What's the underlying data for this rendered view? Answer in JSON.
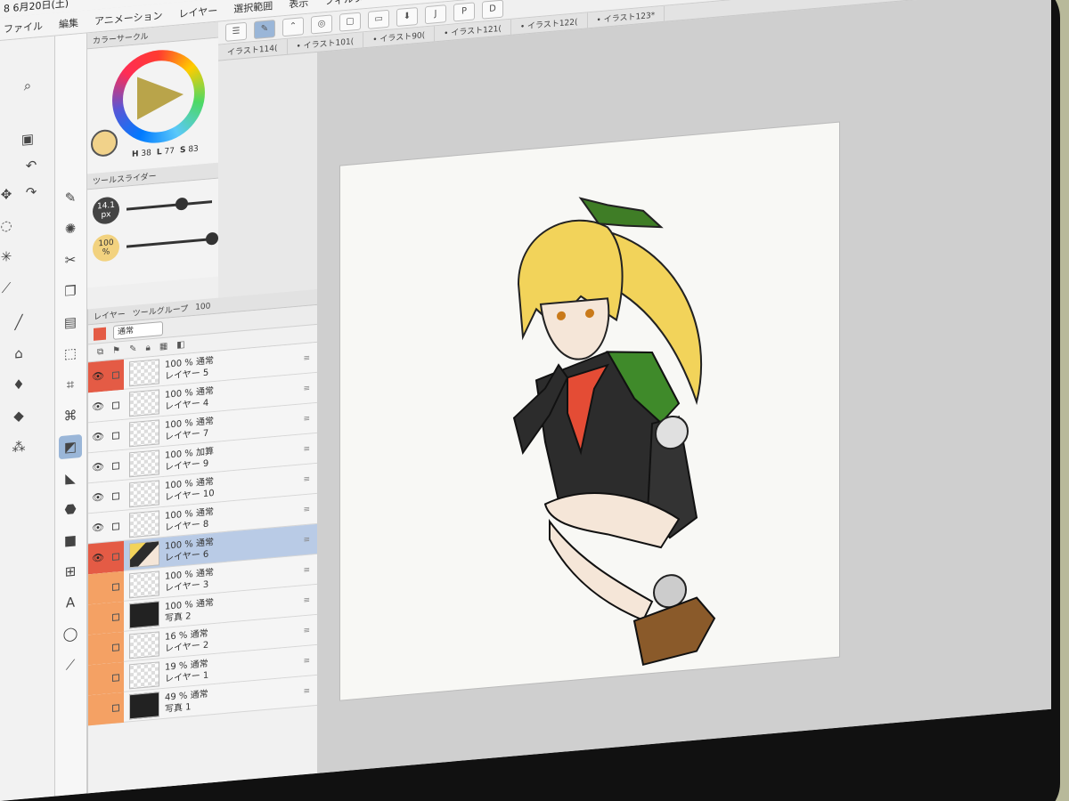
{
  "status": {
    "time_date": "8  6月20日(土)"
  },
  "menu": {
    "items": [
      "ファイル",
      "編集",
      "アニメーション",
      "レイヤー",
      "選択範囲",
      "表示",
      "フィルター"
    ]
  },
  "tabs": [
    "イラスト114(",
    "• イラスト101(",
    "• イラスト90(",
    "• イラスト121(",
    "• イラスト122(",
    "• イラスト123*"
  ],
  "color_circle": {
    "title": "カラーサークル",
    "h_label": "H",
    "h_value": "38",
    "l_label": "L",
    "l_value": "77",
    "s_label": "S",
    "s_value": "83",
    "current_color": "#f1d28a"
  },
  "tool_slider": {
    "title": "ツールスライダー",
    "size_value": "14.1",
    "size_unit": "px",
    "opacity_value": "100",
    "opacity_unit": "%",
    "size_level": 0.65,
    "opacity_level": 1.0
  },
  "layer_panel": {
    "tab_layer": "レイヤー",
    "tab_tool_group": "ツールグループ",
    "opacity_field": "100",
    "blend_mode": "通常",
    "layers": [
      {
        "opacity": "100 %",
        "mode": "通常",
        "name": "レイヤー 5",
        "selected": false,
        "visible": true,
        "mark": "red",
        "thumb": "transparent"
      },
      {
        "opacity": "100 %",
        "mode": "通常",
        "name": "レイヤー 4",
        "selected": false,
        "visible": true,
        "mark": "none",
        "thumb": "transparent"
      },
      {
        "opacity": "100 %",
        "mode": "通常",
        "name": "レイヤー 7",
        "selected": false,
        "visible": true,
        "mark": "none",
        "thumb": "transparent"
      },
      {
        "opacity": "100 %",
        "mode": "加算",
        "name": "レイヤー 9",
        "selected": false,
        "visible": true,
        "mark": "none",
        "thumb": "transparent"
      },
      {
        "opacity": "100 %",
        "mode": "通常",
        "name": "レイヤー 10",
        "selected": false,
        "visible": true,
        "mark": "none",
        "thumb": "transparent"
      },
      {
        "opacity": "100 %",
        "mode": "通常",
        "name": "レイヤー 8",
        "selected": false,
        "visible": true,
        "mark": "none",
        "thumb": "transparent"
      },
      {
        "opacity": "100 %",
        "mode": "通常",
        "name": "レイヤー 6",
        "selected": true,
        "visible": true,
        "mark": "red",
        "thumb": "character"
      },
      {
        "opacity": "100 %",
        "mode": "通常",
        "name": "レイヤー 3",
        "selected": false,
        "visible": false,
        "mark": "orange",
        "thumb": "transparent"
      },
      {
        "opacity": "100 %",
        "mode": "通常",
        "name": "写真 2",
        "selected": false,
        "visible": false,
        "mark": "orange",
        "thumb": "dark"
      },
      {
        "opacity": "16 %",
        "mode": "通常",
        "name": "レイヤー 2",
        "selected": false,
        "visible": false,
        "mark": "orange",
        "thumb": "transparent"
      },
      {
        "opacity": "19 %",
        "mode": "通常",
        "name": "レイヤー 1",
        "selected": false,
        "visible": false,
        "mark": "orange",
        "thumb": "transparent"
      },
      {
        "opacity": "49 %",
        "mode": "通常",
        "name": "写真 1",
        "selected": false,
        "visible": false,
        "mark": "orange",
        "thumb": "dark"
      }
    ]
  },
  "tool_icons": [
    "undo-icon",
    "redo-icon",
    "move-icon",
    "lasso-icon",
    "magic-wand-icon",
    "eyedropper-icon",
    "pen-icon",
    "brush-icon",
    "eraser-icon",
    "fill-icon",
    "gradient-icon",
    "frame-icon",
    "text-icon",
    "balloon-icon",
    "correction-icon"
  ],
  "canvas": {
    "background": "#cfcfcf",
    "paper": "#f8f8f5"
  },
  "colors": {
    "selected_row": "#b9cbe6",
    "mark_red": "#e45b45",
    "mark_orange": "#f4a164"
  }
}
